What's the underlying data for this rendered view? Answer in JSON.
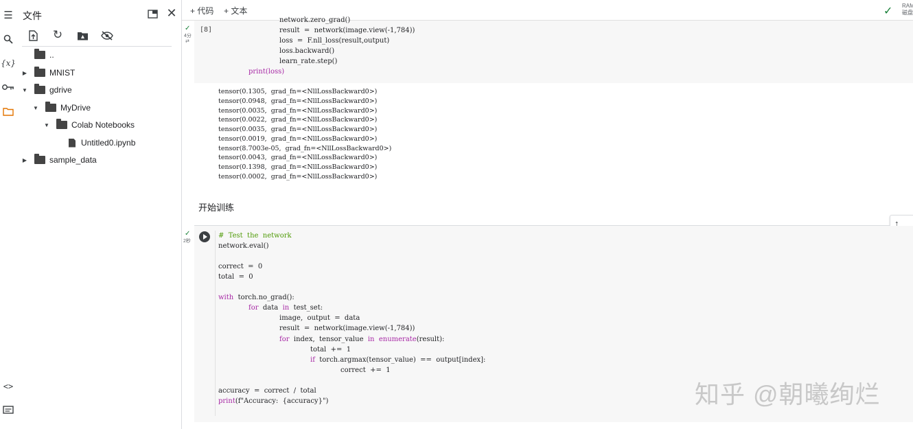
{
  "panel": {
    "title": "文件",
    "icons": [
      "open-in-tab-icon",
      "close-icon",
      "upload-icon",
      "refresh-icon",
      "mount-drive-icon",
      "hide-icon"
    ]
  },
  "rail": {
    "icons": [
      "toc-icon",
      "search-icon",
      "variables-icon",
      "key-icon",
      "folder-icon",
      "code-snippets-icon",
      "terminal-icon"
    ],
    "variables_glyph": "{x}"
  },
  "file_tree": {
    "parent": "..",
    "items": [
      {
        "label": "MNIST",
        "type": "folder",
        "expanded": false
      },
      {
        "label": "gdrive",
        "type": "folder",
        "expanded": true
      },
      {
        "label": "MyDrive",
        "type": "folder",
        "expanded": true
      },
      {
        "label": "Colab Notebooks",
        "type": "folder",
        "expanded": true
      },
      {
        "label": "Untitled0.ipynb",
        "type": "file"
      },
      {
        "label": "sample_data",
        "type": "folder",
        "expanded": false
      }
    ]
  },
  "toolbar": {
    "add_code": "+ 代码",
    "add_text": "+ 文本",
    "ram_label": "RAM",
    "disk_label": "磁盘"
  },
  "cell1": {
    "exec_time": "4分",
    "exec_count": "[8]",
    "lines": [
      "network.zero_grad()",
      "result  =  network(image.view(-1,784))",
      "loss  =  F.nll_loss(result,output)",
      "loss.backward()",
      "learn_rate.step()",
      "print(loss)"
    ],
    "output": [
      "tensor(0.1305,  grad_fn=<NllLossBackward0>)",
      "tensor(0.0948,  grad_fn=<NllLossBackward0>)",
      "tensor(0.0035,  grad_fn=<NllLossBackward0>)",
      "tensor(0.0022,  grad_fn=<NllLossBackward0>)",
      "tensor(0.0035,  grad_fn=<NllLossBackward0>)",
      "tensor(0.0019,  grad_fn=<NllLossBackward0>)",
      "tensor(8.7003e-05,  grad_fn=<NllLossBackward0>)",
      "tensor(0.0043,  grad_fn=<NllLossBackward0>)",
      "tensor(0.1398,  grad_fn=<NllLossBackward0>)",
      "tensor(0.0002,  grad_fn=<NllLossBackward0>)"
    ]
  },
  "text_cell": "开始训练",
  "cell2": {
    "exec_time": "2秒",
    "comment": "#  Test  the  network",
    "lines": {
      "eval": "network.eval()",
      "correct": "correct  =  0",
      "total": "total  =  0",
      "with_kw": "with",
      "with_rest": "  torch.no_grad():",
      "for_kw": "for",
      "for_mid": "  data  ",
      "in_kw": "in",
      "for_rest": "  test_set:",
      "unpack": "image,  output  =  data",
      "result": "result  =  network(image.view(-1,784))",
      "for2_kw": "for",
      "for2_mid": "  index,  tensor_value  ",
      "in2_kw": "in",
      "enum_fn": "enumerate",
      "for2_rest": "(result):",
      "total_inc": "total  +=  1",
      "if_kw": "if",
      "if_rest": "  torch.argmax(tensor_value)  ==  output[index]:",
      "correct_inc": "correct  +=  1",
      "accuracy": "accuracy  =  correct  /  total",
      "print_fn": "print",
      "print_rest": "(f\"Accuracy:  {accuracy}\")"
    }
  },
  "watermark": "知乎 @朝曦绚烂"
}
